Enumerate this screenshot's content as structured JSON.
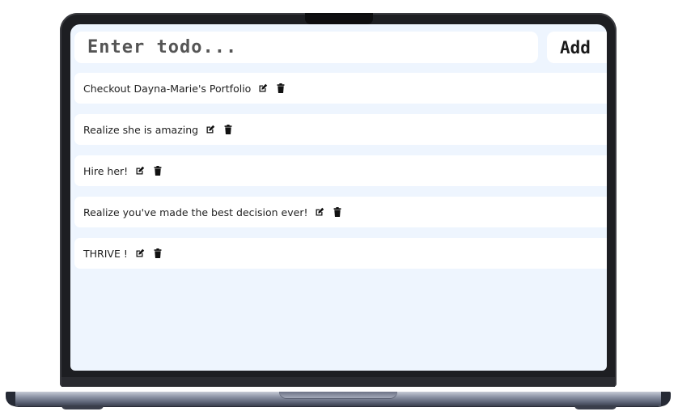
{
  "todo_input": {
    "placeholder": "Enter todo..."
  },
  "add_button": {
    "label": "Add"
  },
  "todos": [
    {
      "text": "Checkout Dayna-Marie's Portfolio"
    },
    {
      "text": "Realize she is amazing"
    },
    {
      "text": "Hire her!"
    },
    {
      "text": "Realize you've made the best decision ever!"
    },
    {
      "text": "THRIVE !"
    }
  ],
  "icons": {
    "edit": "edit-icon",
    "delete": "trash-icon"
  },
  "colors": {
    "screen_background": "#eef5fe",
    "card_background": "#ffffff",
    "laptop_bezel": "#1d1e22",
    "laptop_base": "#8e95a6"
  }
}
